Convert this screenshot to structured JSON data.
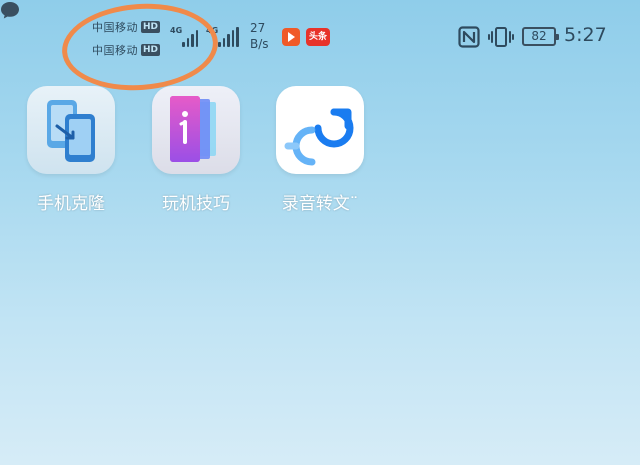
{
  "status_bar": {
    "carriers": [
      {
        "name": "中国移动",
        "badge": "HD"
      },
      {
        "name": "中国移动",
        "badge": "HD"
      }
    ],
    "sim1_network": "4G",
    "sim2_network": "4G",
    "speed_value": "27",
    "speed_unit": "B/s",
    "notification_icons": [
      "video-app-icon",
      "toutiao-app-icon",
      "chat-bubble-icon"
    ],
    "toutiao_label": "头条",
    "system_icons": [
      "nfc-icon",
      "vibrate-icon"
    ],
    "battery_level": "82",
    "time": "5:27"
  },
  "apps": [
    {
      "label": "手机克隆",
      "icon": "phone-clone-icon"
    },
    {
      "label": "玩机技巧",
      "icon": "tips-icon"
    },
    {
      "label": "录音转文¨",
      "icon": "recorder-icon"
    }
  ],
  "colors": {
    "annotation_ring": "#f08a4a",
    "wallpaper_top": "#8fcdea",
    "wallpaper_bottom": "#d6ecf7",
    "clone_blue": "#3a8fd6",
    "tips_purple": "#9b5cf0",
    "recorder_blue": "#1a7cf0"
  }
}
